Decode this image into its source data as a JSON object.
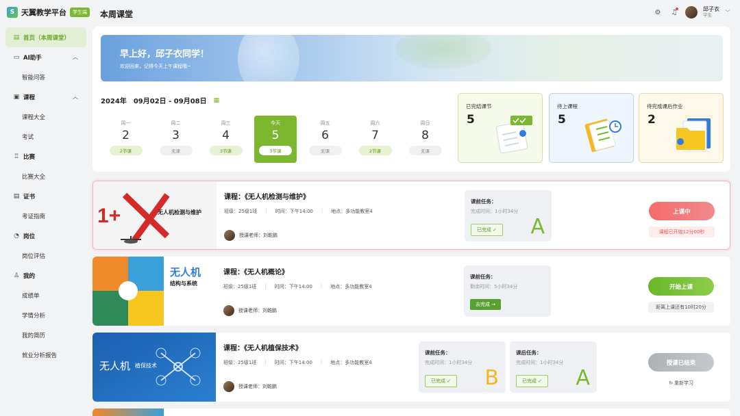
{
  "app": {
    "name": "天翼教学平台",
    "badge": "学生端",
    "page_title": "本周课堂"
  },
  "header": {
    "user_name": "邱子衣",
    "user_role": "学生"
  },
  "sidebar": {
    "items": [
      {
        "label": "首页（本周课堂）",
        "type": "active"
      },
      {
        "label": "AI助手",
        "type": "group"
      },
      {
        "label": "智能问答",
        "type": "sub"
      },
      {
        "label": "课程",
        "type": "group"
      },
      {
        "label": "课程大全",
        "type": "sub"
      },
      {
        "label": "考试",
        "type": "sub"
      },
      {
        "label": "比赛",
        "type": "group"
      },
      {
        "label": "比赛大全",
        "type": "sub"
      },
      {
        "label": "证书",
        "type": "group"
      },
      {
        "label": "考证指南",
        "type": "sub"
      },
      {
        "label": "岗位",
        "type": "group"
      },
      {
        "label": "岗位评估",
        "type": "sub"
      },
      {
        "label": "我的",
        "type": "group"
      },
      {
        "label": "成绩单",
        "type": "sub"
      },
      {
        "label": "学情分析",
        "type": "sub"
      },
      {
        "label": "我的简历",
        "type": "sub"
      },
      {
        "label": "就业分析报告",
        "type": "sub"
      }
    ]
  },
  "banner": {
    "title": "早上好，邱子衣同学！",
    "subtitle": "欢迎回来，记得今天上午课程哦~"
  },
  "week": {
    "year": "2024年",
    "range": "09月02日 - 09月08日"
  },
  "days": [
    {
      "label": "周一",
      "num": "2",
      "pill": "2节课",
      "has": true
    },
    {
      "label": "周二",
      "num": "3",
      "pill": "无课",
      "has": false
    },
    {
      "label": "周三",
      "num": "4",
      "pill": "3节课",
      "has": true
    },
    {
      "label": "今天",
      "num": "5",
      "pill": "3节课",
      "has": true,
      "today": true
    },
    {
      "label": "周五",
      "num": "6",
      "pill": "无课",
      "has": false
    },
    {
      "label": "周六",
      "num": "7",
      "pill": "2节课",
      "has": true
    },
    {
      "label": "周日",
      "num": "8",
      "pill": "无课",
      "has": false
    }
  ],
  "stats": [
    {
      "title": "已完结课节",
      "value": "5"
    },
    {
      "title": "待上课程",
      "value": "5"
    },
    {
      "title": "待完成课后作业",
      "value": "2"
    }
  ],
  "courses": [
    {
      "title": "课程：《无人机检测与维护》",
      "class_label": "班级：25级1班",
      "time_label": "时间：下午14:00",
      "place_label": "地点：多功能教室4",
      "teacher": "授课老师：刘乾鹏",
      "thumb_text": "无人机检测与维护",
      "tasks": [
        {
          "title": "课前任务：",
          "time": "完成时间：1小时34分",
          "btn": "已完成 ✓",
          "grade": "A"
        }
      ],
      "action": "上课中",
      "note": "课程已开始12分00秒"
    },
    {
      "title": "课程：《无人机概论》",
      "class_label": "班级：25级1班",
      "time_label": "时间：下午14:00",
      "place_label": "地点：多功能教室4",
      "teacher": "授课老师：刘乾鹏",
      "thumb_text": "无人机",
      "thumb_sub": "结构与系统",
      "tasks": [
        {
          "title": "课前任务：",
          "time": "剩余时间：5小时34分",
          "btn": "去完成 →"
        }
      ],
      "action": "开始上课",
      "note": "距离上课还有10时20分"
    },
    {
      "title": "课程：《无人机植保技术》",
      "class_label": "班级：25级1班",
      "time_label": "时间：下午14:00",
      "place_label": "地点：多功能教室4",
      "teacher": "授课老师：刘乾鹏",
      "thumb_text": "无人机",
      "thumb_sub": "植保技术",
      "tasks": [
        {
          "title": "课前任务：",
          "time": "完成时间：1小时34分",
          "btn": "已完成 ✓",
          "grade": "B"
        },
        {
          "title": "课后任务：",
          "time": "完成时间：1小时34分",
          "btn": "已完成 ✓",
          "grade": "A"
        }
      ],
      "action": "授课已结束",
      "note": "↻ 重新学习"
    }
  ]
}
